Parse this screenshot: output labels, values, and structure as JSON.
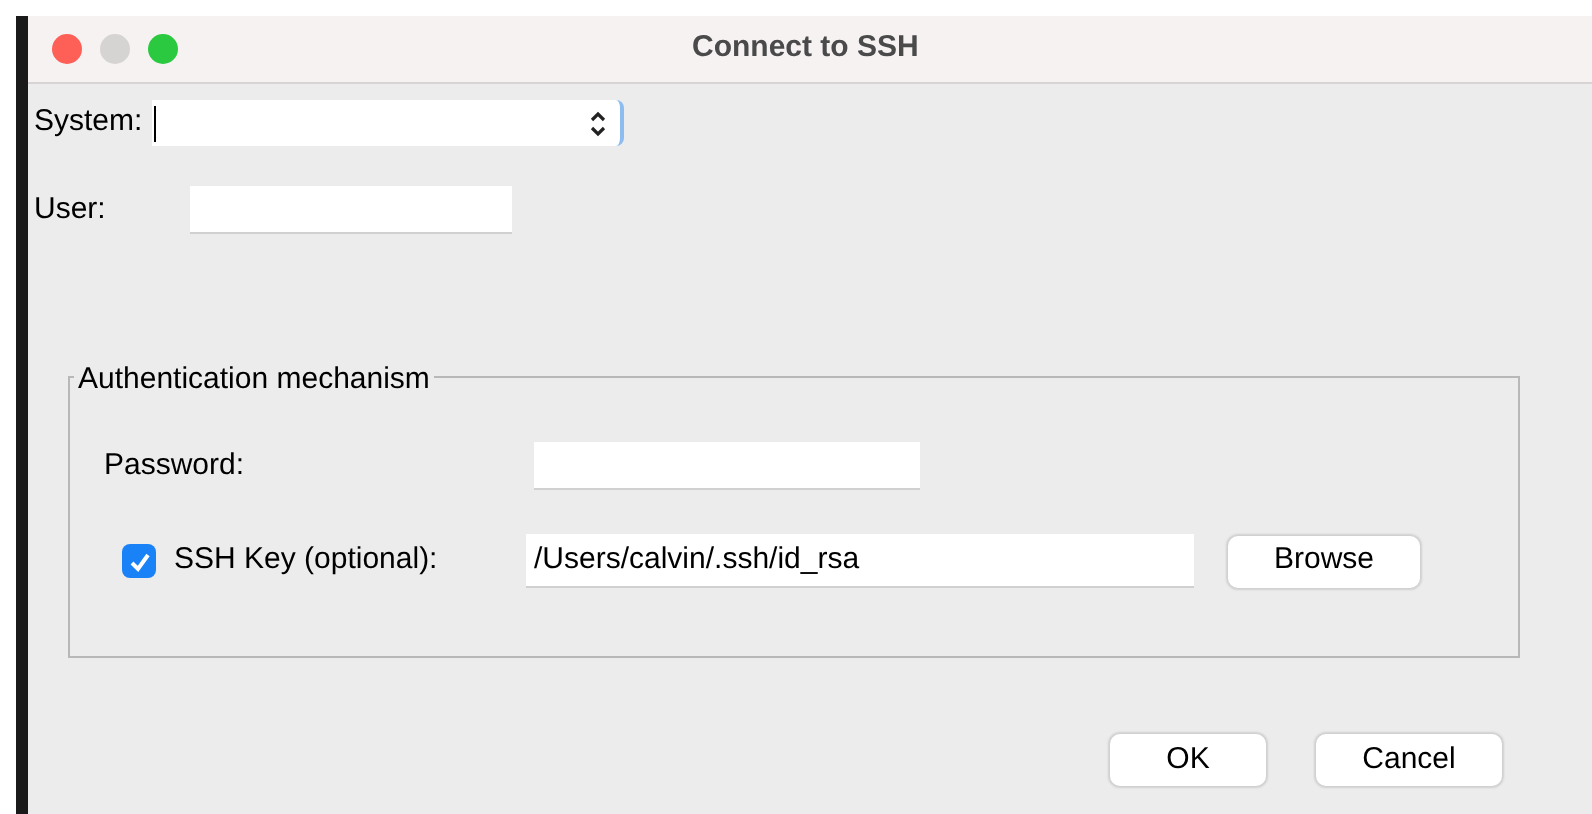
{
  "window": {
    "title": "Connect to SSH"
  },
  "system": {
    "label": "System:"
  },
  "user": {
    "label": "User:"
  },
  "auth": {
    "legend": "Authentication mechanism",
    "password": {
      "label": "Password:"
    },
    "ssh_key": {
      "label": "SSH Key (optional):",
      "checked": true,
      "value": "/Users/calvin/.ssh/id_rsa",
      "button": "Browse"
    }
  },
  "buttons": [
    "OK",
    "Cancel"
  ]
}
